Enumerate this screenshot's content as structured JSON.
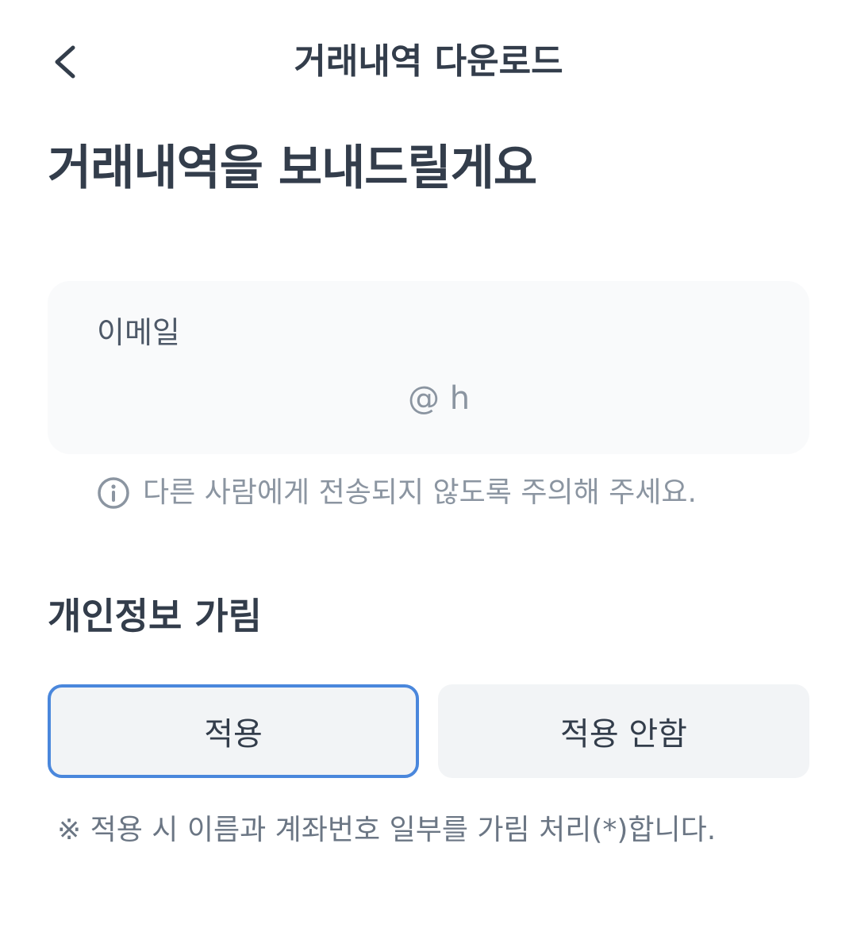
{
  "header": {
    "title": "거래내역 다운로드",
    "back_icon": "chevron-left-icon"
  },
  "page_title": "거래내역을 보내드릴게요",
  "email": {
    "label": "이메일",
    "value": "@ h"
  },
  "notice": {
    "icon": "info-icon",
    "text": "다른 사람에게 전송되지 않도록 주의해 주세요."
  },
  "privacy": {
    "title": "개인정보 가림",
    "options": [
      {
        "label": "적용",
        "selected": true
      },
      {
        "label": "적용 안함",
        "selected": false
      }
    ],
    "footnote": "※ 적용 시 이름과 계좌번호 일부를 가림 처리(*)합니다."
  },
  "colors": {
    "text_primary": "#333d4b",
    "text_secondary": "#8b95a1",
    "selected_border": "#4a87dc",
    "option_bg": "#f2f4f6",
    "card_bg": "#f9fafb"
  }
}
